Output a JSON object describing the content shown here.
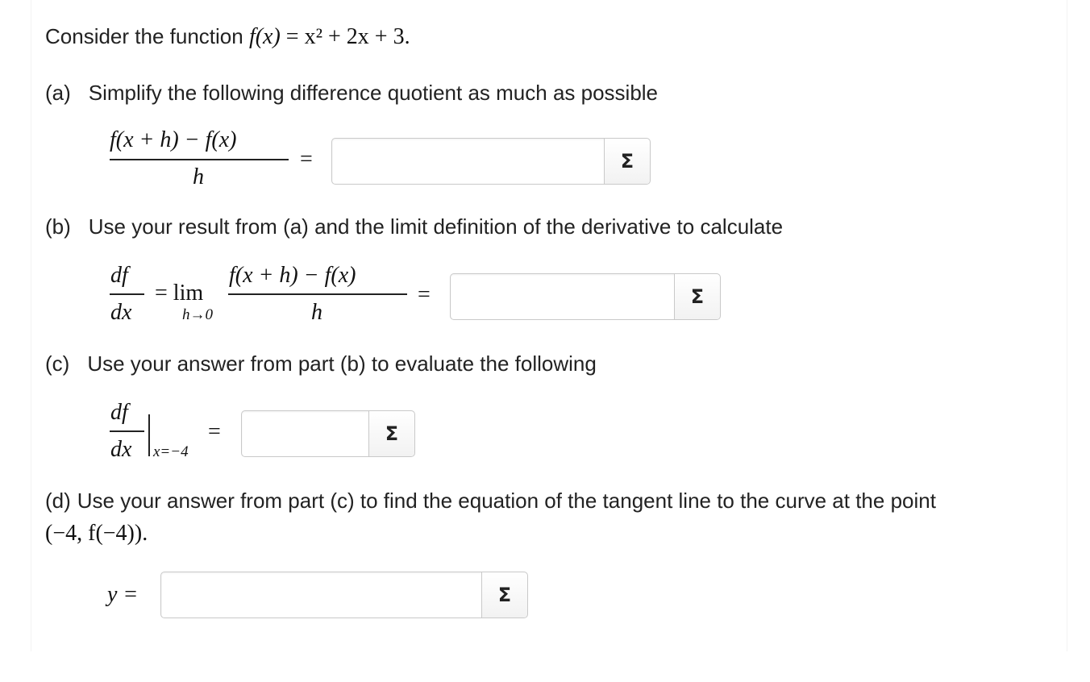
{
  "intro": {
    "text": "Consider the function ",
    "function_lhs": "f(x)",
    "function_rhs": "= x² + 2x + 3."
  },
  "part_a": {
    "label": "(a)",
    "text": "Simplify the following difference quotient as much as possible",
    "numerator": "f(x + h) − f(x)",
    "denominator": "h",
    "equals": "=",
    "sigma": "Σ"
  },
  "part_b": {
    "label": "(b)",
    "text": "Use your result from (a) and the limit definition of the derivative to calculate",
    "df": "df",
    "dx": "dx",
    "equals1": "= lim",
    "limit_sub": "h→0",
    "numerator": "f(x + h) − f(x)",
    "denominator": "h",
    "equals2": "=",
    "sigma": "Σ"
  },
  "part_c": {
    "label": "(c)",
    "text": "Use your answer from part (b) to evaluate the following",
    "df": "df",
    "dx": "dx",
    "eval_sub": "x=−4",
    "equals": "=",
    "sigma": "Σ"
  },
  "part_d": {
    "label": "(d)",
    "text": "Use your answer from part (c) to find the equation of the tangent line to the curve at the point",
    "point": "(−4, f(−4)).",
    "y_label": "y =",
    "sigma": "Σ"
  }
}
